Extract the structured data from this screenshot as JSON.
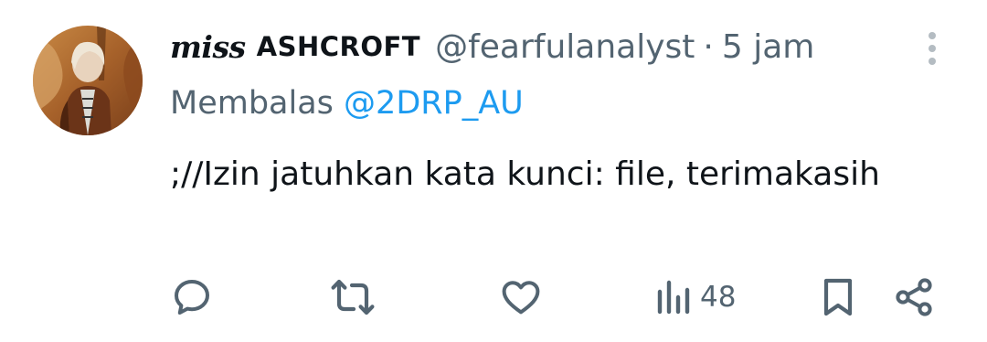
{
  "tweet": {
    "display_name_italic": "miss",
    "display_name_caps": "ASHCROFT",
    "handle": "@fearfulanalyst",
    "separator": "·",
    "timestamp": "5 jam",
    "reply_prefix": "Membalas",
    "reply_to": "@2DRP_AU",
    "text": ";//Izin jatuhkan kata kunci: file, terimakasih"
  },
  "actions": {
    "views_count": "48"
  },
  "icons": {
    "reply": "reply-icon",
    "retweet": "retweet-icon",
    "like": "heart-icon",
    "views": "views-icon",
    "bookmark": "bookmark-icon",
    "share": "share-icon",
    "more": "more-vertical-icon"
  },
  "colors": {
    "text_primary": "#0f1419",
    "text_secondary": "#536471",
    "mention": "#1d9bf0",
    "icon": "#536471"
  }
}
